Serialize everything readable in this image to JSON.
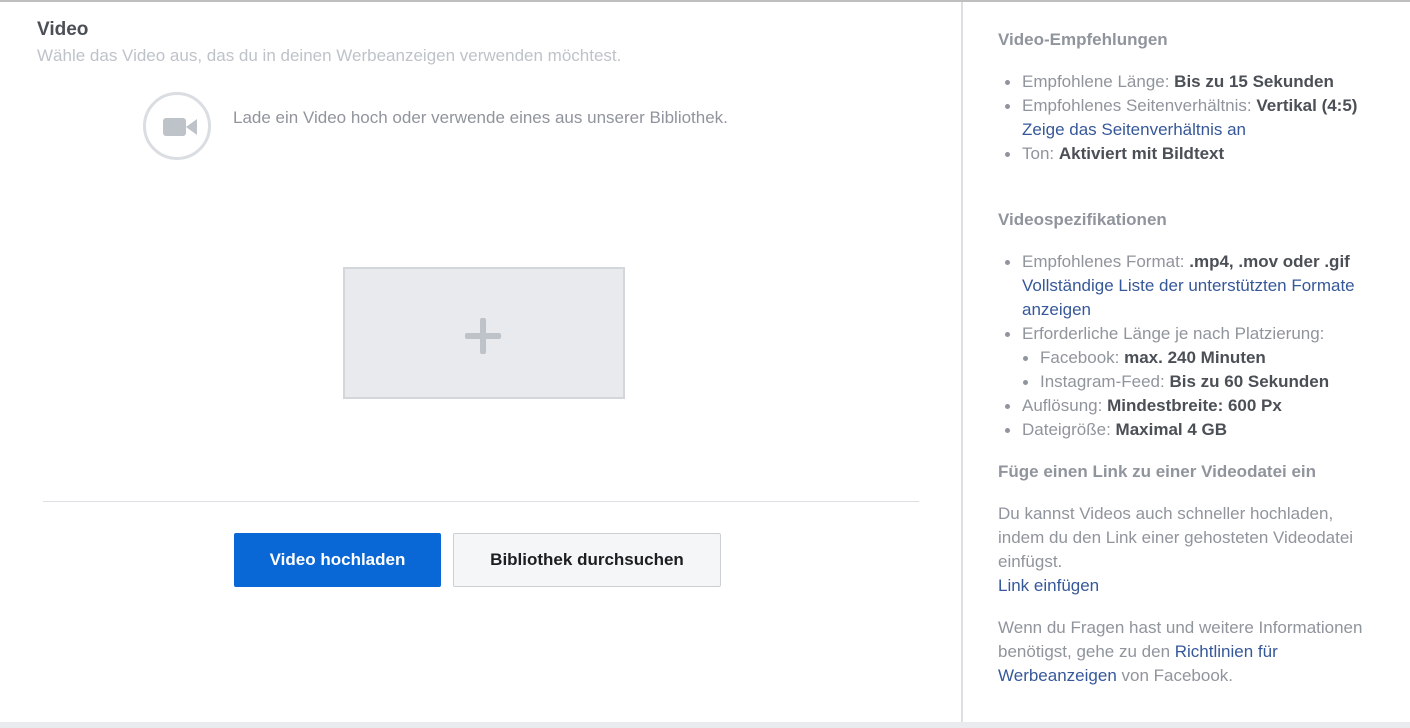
{
  "main": {
    "title": "Video",
    "subtitle": "Wähle das Video aus, das du in deinen Werbeanzeigen verwenden möchtest.",
    "upload_hint": "Lade ein Video hoch oder verwende eines aus unserer Bibliothek.",
    "upload_button": "Video hochladen",
    "library_button": "Bibliothek durchsuchen"
  },
  "sidebar": {
    "recommendations": {
      "heading": "Video-Empfehlungen",
      "length_label": "Empfohlene Länge: ",
      "length_value": "Bis zu 15 Sekunden",
      "ratio_label": "Empfohlenes Seitenverhältnis: ",
      "ratio_value": "Vertikal (4:5)",
      "ratio_link": "Zeige das Seitenverhältnis an",
      "sound_label": "Ton: ",
      "sound_value": "Aktiviert mit Bildtext"
    },
    "specs": {
      "heading": "Videospezifikationen",
      "format_label": "Empfohlenes Format: ",
      "format_value": ".mp4, .mov oder .gif",
      "format_link": "Vollständige Liste der unterstützten Formate anzeigen",
      "length_label": "Erforderliche Länge je nach Platzierung:",
      "facebook_label": "Facebook: ",
      "facebook_value": "max. 240 Minuten",
      "instagram_label": "Instagram-Feed: ",
      "instagram_value": "Bis zu 60 Sekunden",
      "resolution_label": "Auflösung: ",
      "resolution_value": "Mindestbreite: 600 Px",
      "filesize_label": "Dateigröße: ",
      "filesize_value": "Maximal 4 GB"
    },
    "link_section": {
      "heading": "Füge einen Link zu einer Videodatei ein",
      "text": "Du kannst Videos auch schneller hochladen, indem du den Link einer gehosteten Videodatei einfügst.",
      "link": "Link einfügen"
    },
    "help": {
      "text_before": "Wenn du Fragen hast und weitere Informationen benötigst, gehe zu den ",
      "link": "Richtlinien für Werbeanzeigen",
      "text_after": " von Facebook."
    }
  },
  "colors": {
    "primary": "#0a67d6",
    "link": "#365899",
    "muted_text": "#90949c",
    "strong_text": "#4b4f56"
  },
  "icons": [
    "video-camera-icon",
    "plus-icon"
  ]
}
